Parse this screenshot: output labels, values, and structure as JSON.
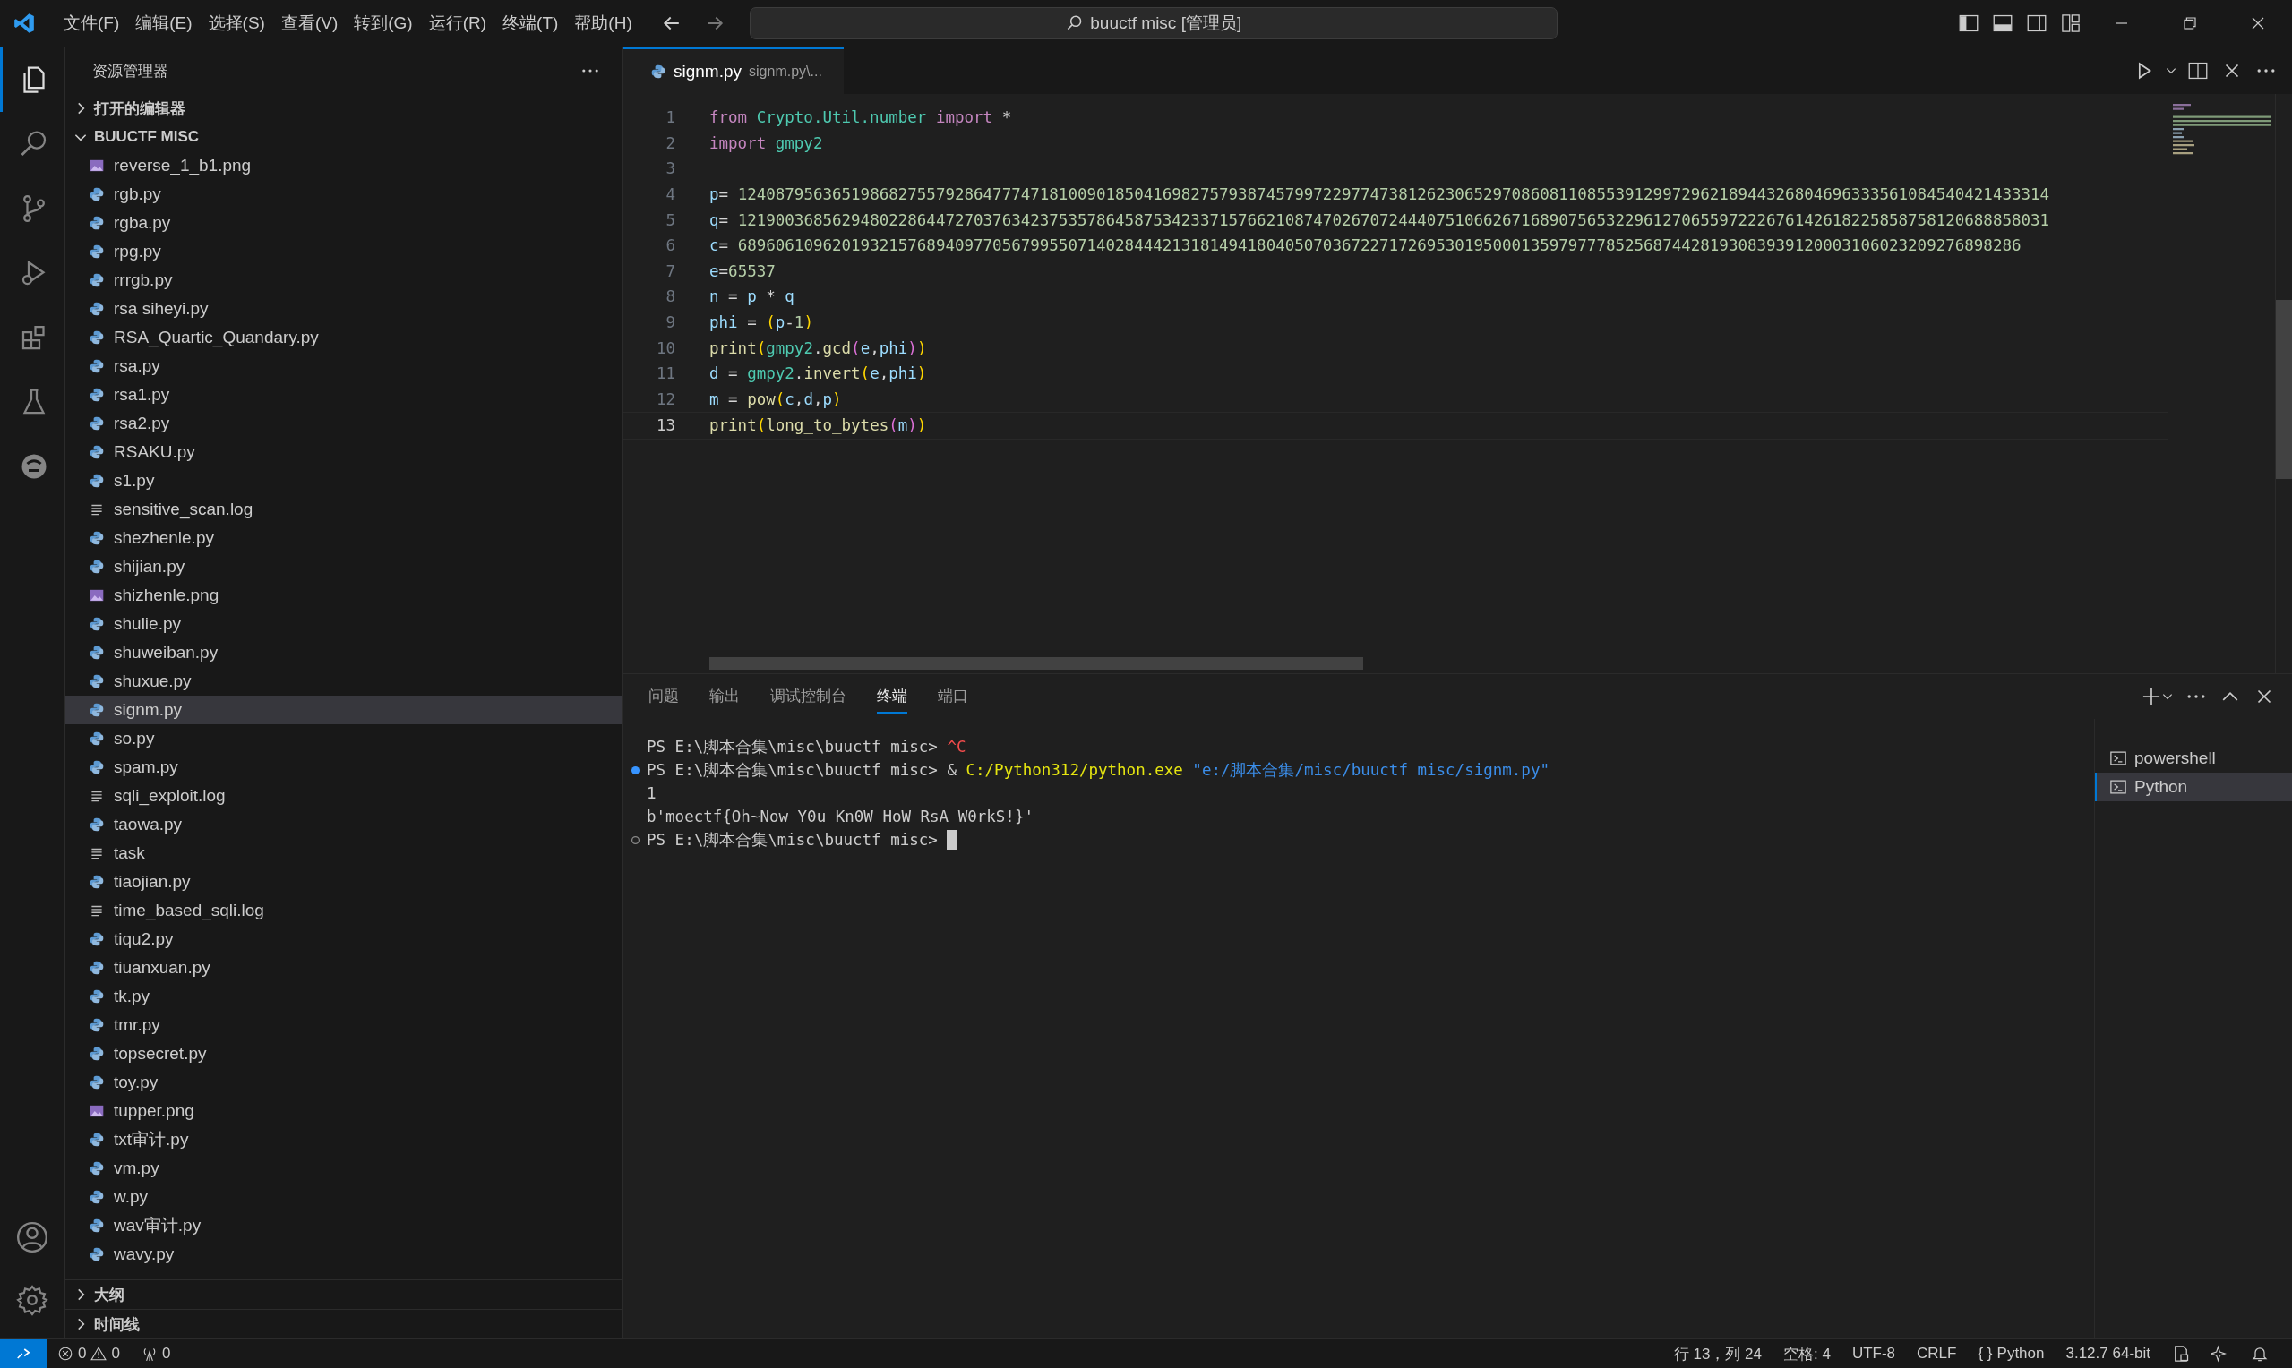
{
  "menu": [
    "文件(F)",
    "编辑(E)",
    "选择(S)",
    "查看(V)",
    "转到(G)",
    "运行(R)",
    "终端(T)",
    "帮助(H)"
  ],
  "search": {
    "value": "buuctf misc [管理员]"
  },
  "activity_bar": [
    {
      "kind": "explorer",
      "selected": true
    },
    {
      "kind": "search",
      "selected": false
    },
    {
      "kind": "source-control",
      "selected": false
    },
    {
      "kind": "run",
      "selected": false
    },
    {
      "kind": "extensions",
      "selected": false
    },
    {
      "kind": "testing",
      "selected": false
    },
    {
      "kind": "remote",
      "selected": false
    }
  ],
  "explorer": {
    "title": "资源管理器",
    "sections": [
      {
        "label": "打开的编辑器",
        "expanded": false
      },
      {
        "label": "BUUCTF MISC",
        "expanded": true,
        "files": [
          {
            "name": "reverse_1_b1.png",
            "kind": "image",
            "selected": false
          },
          {
            "name": "rgb.py",
            "kind": "python",
            "selected": false
          },
          {
            "name": "rgba.py",
            "kind": "python",
            "selected": false
          },
          {
            "name": "rpg.py",
            "kind": "python",
            "selected": false
          },
          {
            "name": "rrrgb.py",
            "kind": "python",
            "selected": false
          },
          {
            "name": "rsa siheyi.py",
            "kind": "python",
            "selected": false
          },
          {
            "name": "RSA_Quartic_Quandary.py",
            "kind": "python",
            "selected": false
          },
          {
            "name": "rsa.py",
            "kind": "python",
            "selected": false
          },
          {
            "name": "rsa1.py",
            "kind": "python",
            "selected": false
          },
          {
            "name": "rsa2.py",
            "kind": "python",
            "selected": false
          },
          {
            "name": "RSAKU.py",
            "kind": "python",
            "selected": false
          },
          {
            "name": "s1.py",
            "kind": "python",
            "selected": false
          },
          {
            "name": "sensitive_scan.log",
            "kind": "text",
            "selected": false
          },
          {
            "name": "shezhenle.py",
            "kind": "python",
            "selected": false
          },
          {
            "name": "shijian.py",
            "kind": "python",
            "selected": false
          },
          {
            "name": "shizhenle.png",
            "kind": "image",
            "selected": false
          },
          {
            "name": "shulie.py",
            "kind": "python",
            "selected": false
          },
          {
            "name": "shuweiban.py",
            "kind": "python",
            "selected": false
          },
          {
            "name": "shuxue.py",
            "kind": "python",
            "selected": false
          },
          {
            "name": "signm.py",
            "kind": "python",
            "selected": true
          },
          {
            "name": "so.py",
            "kind": "python",
            "selected": false
          },
          {
            "name": "spam.py",
            "kind": "python",
            "selected": false
          },
          {
            "name": "sqli_exploit.log",
            "kind": "text",
            "selected": false
          },
          {
            "name": "taowa.py",
            "kind": "python",
            "selected": false
          },
          {
            "name": "task",
            "kind": "text",
            "selected": false
          },
          {
            "name": "tiaojian.py",
            "kind": "python",
            "selected": false
          },
          {
            "name": "time_based_sqli.log",
            "kind": "text",
            "selected": false
          },
          {
            "name": "tiqu2.py",
            "kind": "python",
            "selected": false
          },
          {
            "name": "tiuanxuan.py",
            "kind": "python",
            "selected": false
          },
          {
            "name": "tk.py",
            "kind": "python",
            "selected": false
          },
          {
            "name": "tmr.py",
            "kind": "python",
            "selected": false
          },
          {
            "name": "topsecret.py",
            "kind": "python",
            "selected": false
          },
          {
            "name": "toy.py",
            "kind": "python",
            "selected": false
          },
          {
            "name": "tupper.png",
            "kind": "image",
            "selected": false
          },
          {
            "name": "txt审计.py",
            "kind": "python",
            "selected": false
          },
          {
            "name": "vm.py",
            "kind": "python",
            "selected": false
          },
          {
            "name": "w.py",
            "kind": "python",
            "selected": false
          },
          {
            "name": "wav审计.py",
            "kind": "python",
            "selected": false
          },
          {
            "name": "wavy.py",
            "kind": "python",
            "selected": false
          }
        ]
      },
      {
        "label": "大纲",
        "expanded": false
      },
      {
        "label": "时间线",
        "expanded": false
      }
    ]
  },
  "editor": {
    "tab": {
      "name": "signm.py",
      "description": "signm.py\\..."
    },
    "lines": [
      {
        "number": "1",
        "current": false,
        "tokens": [
          {
            "kind": "keyword",
            "text": "from"
          },
          {
            "kind": "module",
            "text": " Crypto.Util.number"
          },
          {
            "kind": "keyword",
            "text": " import"
          },
          {
            "kind": "operator",
            "text": " *"
          }
        ]
      },
      {
        "number": "2",
        "current": false,
        "tokens": [
          {
            "kind": "keyword",
            "text": "import"
          },
          {
            "kind": "module",
            "text": " gmpy2"
          }
        ]
      },
      {
        "number": "3",
        "current": false
      },
      {
        "number": "4",
        "current": false,
        "tokens": [
          {
            "kind": "variable",
            "text": "p"
          },
          {
            "kind": "operator",
            "text": "= "
          },
          {
            "kind": "number",
            "text": "1240879563651986827557928647774718100901850416982757938745799722977473812623065297086081108553912997296218944326804696333561084540421433314"
          }
        ]
      },
      {
        "number": "5",
        "current": false,
        "tokens": [
          {
            "kind": "variable",
            "text": "q"
          },
          {
            "kind": "operator",
            "text": "= "
          },
          {
            "kind": "number",
            "text": "1219003685629480228644727037634237535786458753423371576621087470267072444075106626716890756532296127065597222676142618225858758120688858031"
          }
        ]
      },
      {
        "number": "6",
        "current": false,
        "tokens": [
          {
            "kind": "variable",
            "text": "c"
          },
          {
            "kind": "operator",
            "text": "= "
          },
          {
            "kind": "number",
            "text": "6896061096201932157689409770567995507140284442131814941804050703672271726953019500013597977785256874428193083939120003106023209276898286"
          }
        ]
      },
      {
        "number": "7",
        "current": false,
        "tokens": [
          {
            "kind": "variable",
            "text": "e"
          },
          {
            "kind": "operator",
            "text": "="
          },
          {
            "kind": "number",
            "text": "65537"
          }
        ]
      },
      {
        "number": "8",
        "current": false,
        "tokens": [
          {
            "kind": "variable",
            "text": "n"
          },
          {
            "kind": "operator",
            "text": " = "
          },
          {
            "kind": "variable",
            "text": "p"
          },
          {
            "kind": "operator",
            "text": " * "
          },
          {
            "kind": "variable",
            "text": "q"
          }
        ]
      },
      {
        "number": "9",
        "current": false,
        "tokens": [
          {
            "kind": "variable",
            "text": "phi"
          },
          {
            "kind": "operator",
            "text": " = "
          },
          {
            "kind": "bracket",
            "text": "("
          },
          {
            "kind": "variable",
            "text": "p"
          },
          {
            "kind": "operator",
            "text": "-"
          },
          {
            "kind": "number",
            "text": "1"
          },
          {
            "kind": "bracket",
            "text": ")"
          }
        ]
      },
      {
        "number": "10",
        "current": false,
        "tokens": [
          {
            "kind": "function",
            "text": "print"
          },
          {
            "kind": "bracket",
            "text": "("
          },
          {
            "kind": "module",
            "text": "gmpy2"
          },
          {
            "kind": "operator",
            "text": "."
          },
          {
            "kind": "function",
            "text": "gcd"
          },
          {
            "kind": "bracket2",
            "text": "("
          },
          {
            "kind": "variable",
            "text": "e"
          },
          {
            "kind": "operator",
            "text": ","
          },
          {
            "kind": "variable",
            "text": "phi"
          },
          {
            "kind": "bracket2",
            "text": ")"
          },
          {
            "kind": "bracket",
            "text": ")"
          }
        ]
      },
      {
        "number": "11",
        "current": false,
        "tokens": [
          {
            "kind": "variable",
            "text": "d"
          },
          {
            "kind": "operator",
            "text": " = "
          },
          {
            "kind": "module",
            "text": "gmpy2"
          },
          {
            "kind": "operator",
            "text": "."
          },
          {
            "kind": "function",
            "text": "invert"
          },
          {
            "kind": "bracket",
            "text": "("
          },
          {
            "kind": "variable",
            "text": "e"
          },
          {
            "kind": "operator",
            "text": ","
          },
          {
            "kind": "variable",
            "text": "phi"
          },
          {
            "kind": "bracket",
            "text": ")"
          }
        ]
      },
      {
        "number": "12",
        "current": false,
        "tokens": [
          {
            "kind": "variable",
            "text": "m"
          },
          {
            "kind": "operator",
            "text": " = "
          },
          {
            "kind": "function",
            "text": "pow"
          },
          {
            "kind": "bracket",
            "text": "("
          },
          {
            "kind": "variable",
            "text": "c"
          },
          {
            "kind": "operator",
            "text": ","
          },
          {
            "kind": "variable",
            "text": "d"
          },
          {
            "kind": "operator",
            "text": ","
          },
          {
            "kind": "variable",
            "text": "p"
          },
          {
            "kind": "bracket",
            "text": ")"
          }
        ]
      },
      {
        "number": "13",
        "current": true,
        "tokens": [
          {
            "kind": "function",
            "text": "print"
          },
          {
            "kind": "bracket",
            "text": "("
          },
          {
            "kind": "function",
            "text": "long_to_bytes"
          },
          {
            "kind": "bracket2",
            "text": "("
          },
          {
            "kind": "variable",
            "text": "m"
          },
          {
            "kind": "bracket2",
            "text": ")"
          },
          {
            "kind": "bracket",
            "text": ")"
          }
        ]
      }
    ]
  },
  "panel": {
    "tabs": [
      {
        "label": "问题",
        "selected": false
      },
      {
        "label": "输出",
        "selected": false
      },
      {
        "label": "调试控制台",
        "selected": false
      },
      {
        "label": "终端",
        "selected": true
      },
      {
        "label": "端口",
        "selected": false
      }
    ],
    "terminal_lines": [
      {
        "kind": "plain",
        "segments": [
          {
            "kind": "plain",
            "text": "PS E:\\脚本合集\\misc\\buuctf misc> "
          },
          {
            "kind": "error",
            "text": "^C"
          }
        ]
      },
      {
        "kind": "success",
        "segments": [
          {
            "kind": "plain",
            "text": "PS E:\\脚本合集\\misc\\buuctf misc> & "
          },
          {
            "kind": "command",
            "text": "C:/Python312/python.exe"
          },
          {
            "kind": "string",
            "text": " \"e:/脚本合集/misc/buuctf misc/signm.py\""
          }
        ]
      },
      {
        "kind": "plain",
        "segments": [
          {
            "kind": "plain",
            "text": "1"
          }
        ]
      },
      {
        "kind": "plain",
        "segments": [
          {
            "kind": "plain",
            "text": "b'moectf{Oh~Now_Y0u_Kn0W_HoW_RsA_W0rkS!}'"
          }
        ]
      },
      {
        "kind": "idle",
        "cursor": true,
        "segments": [
          {
            "kind": "plain",
            "text": "PS E:\\脚本合集\\misc\\buuctf misc> "
          }
        ]
      }
    ],
    "terminals": [
      {
        "name": "powershell",
        "selected": false
      },
      {
        "name": "Python",
        "selected": true
      }
    ]
  },
  "status_bar": {
    "errors": "0",
    "warnings": "0",
    "ports": "0",
    "position": "行 13，列 24",
    "indent": "空格: 4",
    "encoding": "UTF-8",
    "eol": "CRLF",
    "braces": "{ }",
    "language": "Python",
    "interpreter": "3.12.7 64-bit"
  }
}
